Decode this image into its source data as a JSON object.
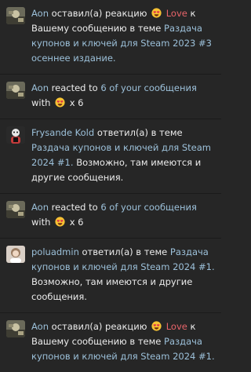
{
  "alerts": [
    {
      "type": "reaction",
      "avatar": "meme-avatar-icon",
      "user": "Aon",
      "verb": "оставил(а) реакцию",
      "reaction": "Love",
      "tail": "к Вашему сообщению в теме",
      "thread": "Раздача купонов и ключей для Steam 2023 #3 осеннее издание."
    },
    {
      "type": "reacted",
      "avatar": "meme-avatar-icon",
      "user": "Aon",
      "verb": "reacted to",
      "count_text": "6 of your сообщения",
      "with": "with",
      "multiplier": "x 6"
    },
    {
      "type": "reply",
      "avatar": "cartoon-avatar-icon",
      "user": "Frysande Kold",
      "verb": "ответил(а) в теме",
      "thread": "Раздача купонов и ключей для Steam 2024 #1.",
      "tail": "Возможно, там имеются и другие сообщения."
    },
    {
      "type": "reacted",
      "avatar": "meme-avatar-icon",
      "user": "Aon",
      "verb": "reacted to",
      "count_text": "6 of your сообщения",
      "with": "with",
      "multiplier": "x 6"
    },
    {
      "type": "reply",
      "avatar": "girl-avatar-icon",
      "user": "poluadmin",
      "verb": "ответил(а) в теме",
      "thread": "Раздача купонов и ключей для Steam 2024 #1.",
      "tail": "Возможно, там имеются и другие сообщения."
    },
    {
      "type": "reaction",
      "avatar": "meme-avatar-icon",
      "user": "Aon",
      "verb": "оставил(а) реакцию",
      "reaction": "Love",
      "tail": "к Вашему сообщению в теме",
      "thread": "Раздача купонов и ключей для Steam 2024 #1."
    }
  ],
  "colors": {
    "background": "#262626",
    "username": "#9cc0d9",
    "link": "#9cc0d9",
    "text": "#ececec",
    "reaction": "#e8646a"
  },
  "icons": {
    "reaction_emoji": "heart-eyes-emoji-icon"
  }
}
